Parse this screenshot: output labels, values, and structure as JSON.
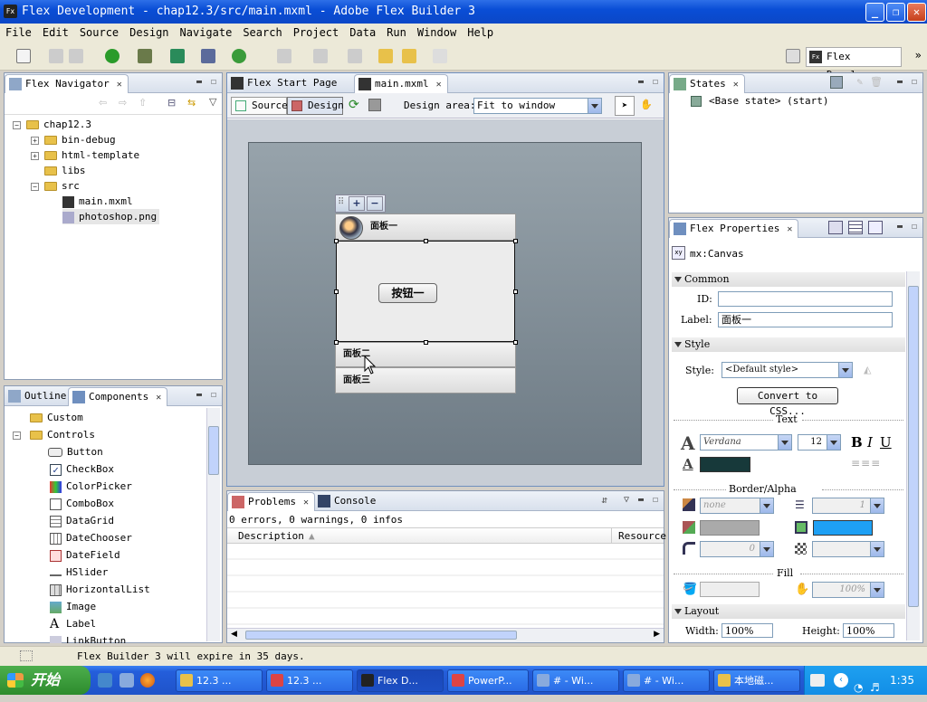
{
  "window": {
    "title": "Flex Development - chap12.3/src/main.mxml - Adobe Flex Builder 3",
    "app_icon": "Fx"
  },
  "menu": [
    "File",
    "Edit",
    "Source",
    "Design",
    "Navigate",
    "Search",
    "Project",
    "Data",
    "Run",
    "Window",
    "Help"
  ],
  "perspective": {
    "label": "Flex Devel..."
  },
  "navigator": {
    "tab": "Flex Navigator",
    "tree": [
      {
        "label": "chap12.3",
        "level": 0,
        "type": "project"
      },
      {
        "label": "bin-debug",
        "level": 1,
        "type": "folder"
      },
      {
        "label": "html-template",
        "level": 1,
        "type": "folder"
      },
      {
        "label": "libs",
        "level": 1,
        "type": "folder"
      },
      {
        "label": "src",
        "level": 1,
        "type": "folder"
      },
      {
        "label": "main.mxml",
        "level": 2,
        "type": "mxml"
      },
      {
        "label": "photoshop.png",
        "level": 2,
        "type": "png"
      }
    ]
  },
  "editor": {
    "tabs": [
      "Flex Start Page",
      "main.mxml"
    ],
    "source_label": "Source",
    "design_label": "Design",
    "design_area_label": "Design area:",
    "design_area_value": "Fit to window",
    "accordion": {
      "panel1": "面板一",
      "panel2": "面板二",
      "panel3": "面板三",
      "button": "按钮一"
    }
  },
  "outline_components": {
    "tabs": [
      "Outline",
      "Components"
    ],
    "items": [
      {
        "label": "Custom",
        "type": "folder",
        "level": 0
      },
      {
        "label": "Controls",
        "type": "folder",
        "level": 0
      },
      {
        "label": "Button",
        "type": "comp",
        "level": 1
      },
      {
        "label": "CheckBox",
        "type": "comp",
        "level": 1
      },
      {
        "label": "ColorPicker",
        "type": "comp",
        "level": 1
      },
      {
        "label": "ComboBox",
        "type": "comp",
        "level": 1
      },
      {
        "label": "DataGrid",
        "type": "comp",
        "level": 1
      },
      {
        "label": "DateChooser",
        "type": "comp",
        "level": 1
      },
      {
        "label": "DateField",
        "type": "comp",
        "level": 1
      },
      {
        "label": "HSlider",
        "type": "comp",
        "level": 1
      },
      {
        "label": "HorizontalList",
        "type": "comp",
        "level": 1
      },
      {
        "label": "Image",
        "type": "comp",
        "level": 1
      },
      {
        "label": "Label",
        "type": "comp",
        "level": 1
      },
      {
        "label": "LinkButton",
        "type": "comp",
        "level": 1
      }
    ]
  },
  "problems": {
    "tabs": [
      "Problems",
      "Console"
    ],
    "summary": "0 errors, 0 warnings, 0 infos",
    "columns": [
      "Description",
      "Resource"
    ]
  },
  "states": {
    "tab": "States",
    "item": "<Base state> (start)"
  },
  "properties": {
    "tab": "Flex Properties",
    "component": "mx:Canvas",
    "common_head": "Common",
    "id_label": "ID:",
    "id_value": "",
    "label_label": "Label:",
    "label_value": "面板一",
    "style_head": "Style",
    "style_label": "Style:",
    "style_value": "<Default style>",
    "convert_button": "Convert to CSS...",
    "text_head": "Text",
    "font_value": "Verdana",
    "font_size": "12",
    "text_color": "#17393a",
    "border_alpha_head": "Border/Alpha",
    "border_style": "none",
    "border_thickness": "1",
    "corner_radius": "0",
    "background_color": "#1ea0f4",
    "fill_head": "Fill",
    "fill_alpha": "100%",
    "layout_head": "Layout",
    "width_label": "Width:",
    "width_value": "100%",
    "height_label": "Height:",
    "height_value": "100%"
  },
  "status": {
    "message": "Flex Builder 3 will expire in 35 days."
  },
  "taskbar": {
    "start": "开始",
    "tasks": [
      "12.3 ...",
      "12.3 ...",
      "Flex D...",
      "PowerP...",
      "# - Wi...",
      "# - Wi...",
      "本地磁..."
    ],
    "clock": "1:35"
  }
}
